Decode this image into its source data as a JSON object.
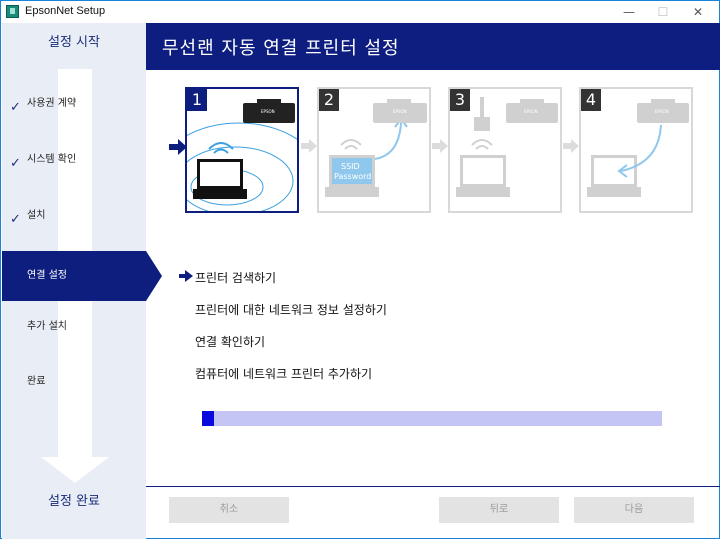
{
  "window": {
    "title": "EpsonNet Setup",
    "min_glyph": "—",
    "max_glyph": "☐",
    "close_glyph": "✕"
  },
  "sidebar": {
    "top_label": "설정 시작",
    "bottom_label": "설정 완료",
    "items": [
      {
        "label": "사용권 계약",
        "checked": true
      },
      {
        "label": "시스템 확인",
        "checked": true
      },
      {
        "label": "설치",
        "checked": true
      },
      {
        "label": "연결 설정",
        "active": true
      },
      {
        "label": "추가 설치"
      },
      {
        "label": "완료"
      }
    ],
    "check_glyph": "✓"
  },
  "header": {
    "title": "무선랜 자동 연결 프린터 설정"
  },
  "steps": [
    {
      "number": "1",
      "active": true,
      "printer_brand": "EPSON"
    },
    {
      "number": "2",
      "printer_brand": "EPSON",
      "ssid_label": "SSID",
      "password_label": "Password"
    },
    {
      "number": "3",
      "printer_brand": "EPSON"
    },
    {
      "number": "4",
      "printer_brand": "EPSON"
    }
  ],
  "tasks": [
    {
      "label": "프린터 검색하기",
      "current": true
    },
    {
      "label": "프린터에 대한 네트워크 정보 설정하기"
    },
    {
      "label": "연결 확인하기"
    },
    {
      "label": "컴퓨터에 네트워크 프린터 추가하기"
    }
  ],
  "progress": {
    "fraction": 0.025
  },
  "buttons": {
    "cancel": "취소",
    "back": "뒤로",
    "next": "다음"
  },
  "colors": {
    "accent": "#0d1e80",
    "progress_fill": "#0a0adf",
    "progress_track": "#c4c4f5",
    "sidebar_bg": "#e9eef6"
  }
}
